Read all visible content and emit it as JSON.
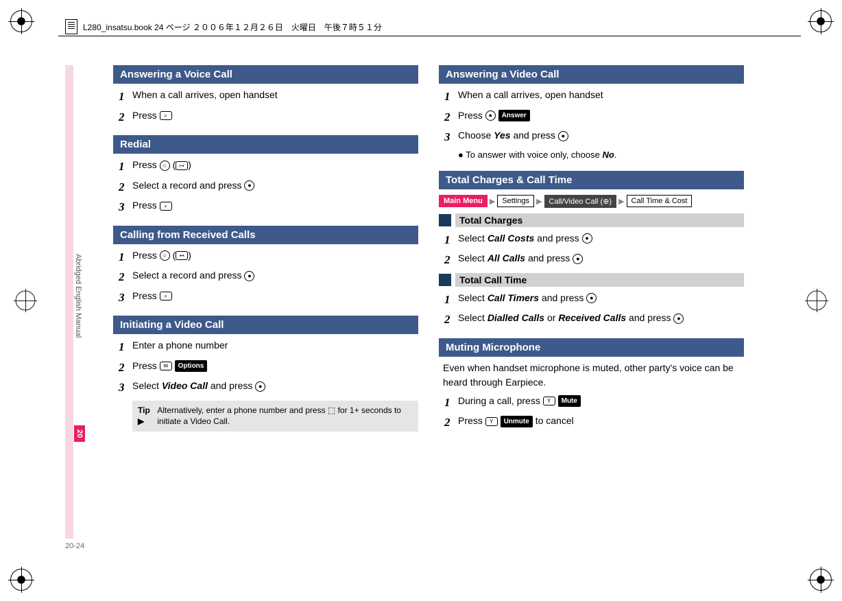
{
  "header": {
    "filename": "L280_insatsu.book 24 ページ ２００６年１２月２６日　火曜日　午後７時５１分"
  },
  "side": {
    "manual_label": "Abridged English Manual",
    "page_tab": "20",
    "page_number": "20-24"
  },
  "left_column": {
    "s1": {
      "title": "Answering a Voice Call",
      "step1": "When a call arrives, open handset",
      "step2a": "Press"
    },
    "s2": {
      "title": "Redial",
      "step1a": "Press",
      "step2": "Select a record and press",
      "step3": "Press"
    },
    "s3": {
      "title": "Calling from Received Calls",
      "step1a": "Press",
      "step2": "Select a record and press",
      "step3": "Press"
    },
    "s4": {
      "title": "Initiating a Video Call",
      "step1": "Enter a phone number",
      "step2a": "Press",
      "step2b": "Options",
      "step3a": "Select",
      "step3b": "Video Call",
      "step3c": "and press",
      "tip_label": "Tip ▶",
      "tip": "Alternatively, enter a phone number and press ⬚ for 1+ seconds to initiate a Video Call."
    }
  },
  "right_column": {
    "s5": {
      "title": "Answering a Video Call",
      "step1": "When a call arrives, open handset",
      "step2a": "Press",
      "step2b": "Answer",
      "step3a": "Choose",
      "step3b": "Yes",
      "step3c": "and press",
      "bullet1a": "To answer with voice only, choose",
      "bullet1b": "No"
    },
    "s6": {
      "title": "Total Charges & Call Time",
      "nav": {
        "a": "Main Menu",
        "b": "Settings",
        "c": "Call/Video Call (⊕)",
        "d": "Call Time & Cost"
      },
      "sub1": "Total Charges",
      "sub1_step1a": "Select",
      "sub1_step1b": "Call Costs",
      "sub1_step1c": "and press",
      "sub1_step2a": "Select",
      "sub1_step2b": "All Calls",
      "sub1_step2c": "and press",
      "sub2": "Total Call Time",
      "sub2_step1a": "Select",
      "sub2_step1b": "Call Timers",
      "sub2_step1c": "and press",
      "sub2_step2a": "Select",
      "sub2_step2b": "Dialled Calls",
      "sub2_step2c": "or",
      "sub2_step2d": "Received Calls",
      "sub2_step2e": "and press"
    },
    "s7": {
      "title": "Muting Microphone",
      "intro": "Even when handset microphone is muted, other party's voice can be heard through Earpiece.",
      "step1a": "During a call, press",
      "step1b": "Mute",
      "step2a": "Press",
      "step2b": "Unmute",
      "step2c": "to cancel"
    }
  }
}
